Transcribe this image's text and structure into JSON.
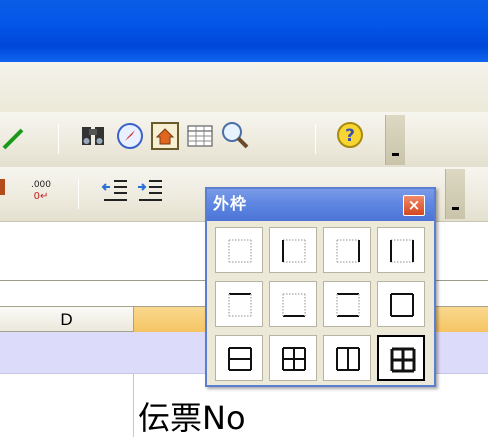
{
  "columns": {
    "d_label": "D"
  },
  "cell": {
    "text": "伝票No"
  },
  "toolbar1": {
    "icons": [
      "line-draw-icon",
      "find-icon",
      "navigator-icon",
      "home-page-icon",
      "table-icon",
      "zoom-icon",
      "help-icon"
    ]
  },
  "toolbar2": {
    "icons": [
      "decimal-add-icon",
      "indent-decrease-icon",
      "indent-increase-icon"
    ],
    "decimal_glyph_top": ".000",
    "decimal_glyph_bottom": "0↵"
  },
  "palette": {
    "title": "外枠",
    "close_label": "×",
    "buttons": [
      {
        "name": "border-none",
        "selected": false
      },
      {
        "name": "border-left",
        "selected": false
      },
      {
        "name": "border-right",
        "selected": false
      },
      {
        "name": "border-left-right",
        "selected": false
      },
      {
        "name": "border-top",
        "selected": false
      },
      {
        "name": "border-bottom",
        "selected": false
      },
      {
        "name": "border-top-bottom",
        "selected": false
      },
      {
        "name": "border-outside",
        "selected": false
      },
      {
        "name": "border-outside-horizontal",
        "selected": false
      },
      {
        "name": "border-all",
        "selected": false
      },
      {
        "name": "border-outside-vertical",
        "selected": false
      },
      {
        "name": "border-all-thick",
        "selected": true
      }
    ]
  },
  "colors": {
    "titlebar": "#0356e8",
    "selection_row": "#dcdcfa",
    "selected_column_header": "#f5c462",
    "palette_title": "#5e86e2",
    "palette_close": "#d3471f"
  }
}
